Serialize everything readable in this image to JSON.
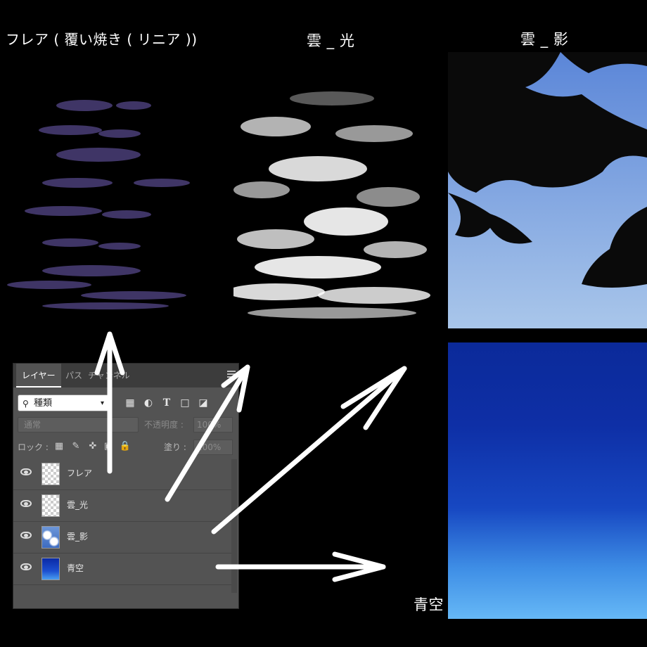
{
  "captions": {
    "flare": "フレア ( 覆い焼き ( リニア ))",
    "cloud_light": "雲 _ 光",
    "cloud_shadow": "雲 _ 影",
    "blue_sky": "青空"
  },
  "layers_panel": {
    "tabs": [
      {
        "label": "レイヤー",
        "active": true
      },
      {
        "label": "パス",
        "active": false
      },
      {
        "label": "チャンネル",
        "active": false
      }
    ],
    "filter_kind": "種類",
    "filter_icons": [
      "image-filter-icon",
      "adjustment-filter-icon",
      "type-filter-icon",
      "shape-filter-icon",
      "smart-object-filter-icon"
    ],
    "blend_mode": "通常",
    "opacity_label": "不透明度 :",
    "opacity_value": "100%",
    "lock_label": "ロック :",
    "lock_icons": [
      "lock-transparent-pixels-icon",
      "lock-image-pixels-icon",
      "lock-position-icon",
      "lock-artboard-icon",
      "lock-all-icon"
    ],
    "fill_label": "塗り :",
    "fill_value": "100%",
    "layers": [
      {
        "name": "フレア",
        "thumb": "transparent",
        "visible": true
      },
      {
        "name": "雲_光",
        "thumb": "transparent",
        "visible": true
      },
      {
        "name": "雲_影",
        "thumb": "cloud",
        "visible": true
      },
      {
        "name": "青空",
        "thumb": "sky",
        "visible": true
      }
    ]
  },
  "colors": {
    "background": "#000000",
    "panel": "#535353",
    "sky_top": "#0b2a9a",
    "sky_bottom": "#5fb2f5",
    "flare_tint": "#4a3f6e"
  }
}
